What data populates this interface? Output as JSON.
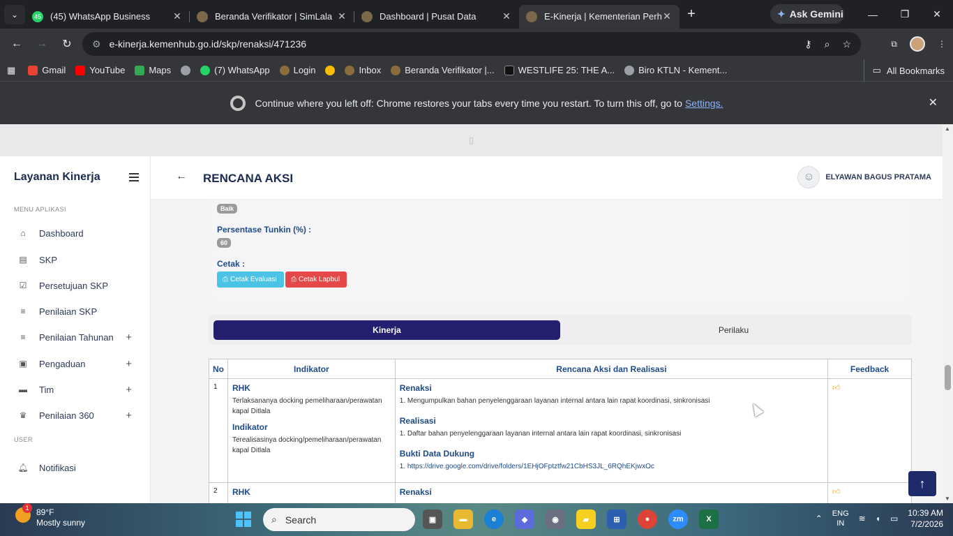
{
  "browser": {
    "tabs": [
      {
        "title": "(45) WhatsApp Business",
        "badge": "45",
        "color": "#25d366"
      },
      {
        "title": "Beranda Verifikator | SimLala",
        "badge": "",
        "color": "#8a8a8a"
      },
      {
        "title": "Dashboard | Pusat Data",
        "badge": "",
        "color": "#8a8a8a"
      },
      {
        "title": "E-Kinerja | Kementerian Perhub",
        "badge": "",
        "color": "#8a8a8a"
      }
    ],
    "gemini_label": "Ask Gemini",
    "url": "e-kinerja.kemenhub.go.id/skp/renaksi/471236",
    "bookmarks": [
      {
        "label": "Gmail",
        "color": "#ea4335"
      },
      {
        "label": "YouTube",
        "color": "#ff0000"
      },
      {
        "label": "Maps",
        "color": "#34a853"
      },
      {
        "label": "",
        "color": "#9aa0a6"
      },
      {
        "label": "(7) WhatsApp",
        "color": "#25d366"
      },
      {
        "label": "Login",
        "color": "#8a6d3b"
      },
      {
        "label": "",
        "color": "#fbbc04"
      },
      {
        "label": "Inbox",
        "color": "#8a6d3b"
      },
      {
        "label": "Beranda Verifikator |...",
        "color": "#8a6d3b"
      },
      {
        "label": "WESTLIFE 25: THE A...",
        "color": "#111111"
      },
      {
        "label": "Biro KTLN - Kement...",
        "color": "#9aa0a6"
      }
    ],
    "all_bookmarks": "All Bookmarks",
    "banner_text": "Continue where you left off: Chrome restores your tabs every time you restart. To turn this off, go to",
    "banner_link": "Settings."
  },
  "app": {
    "brand": "Layanan Kinerja",
    "menu_section": "MENU APLIKASI",
    "menu": [
      {
        "label": "Dashboard",
        "icon": "home-icon",
        "plus": false
      },
      {
        "label": "SKP",
        "icon": "document-icon",
        "plus": false
      },
      {
        "label": "Persetujuan SKP",
        "icon": "check-square-icon",
        "plus": false
      },
      {
        "label": "Penilaian SKP",
        "icon": "list-icon",
        "plus": false
      },
      {
        "label": "Penilaian Tahunan",
        "icon": "list-icon",
        "plus": true
      },
      {
        "label": "Pengaduan",
        "icon": "message-icon",
        "plus": true
      },
      {
        "label": "Tim",
        "icon": "tag-icon",
        "plus": true
      },
      {
        "label": "Penilaian 360",
        "icon": "crown-icon",
        "plus": true
      }
    ],
    "user_section": "USER",
    "user_menu": [
      {
        "label": "Notifikasi",
        "icon": "bell-icon"
      }
    ],
    "page_title": "RENCANA AKSI",
    "user_name": "ELYAWAN BAGUS PRATAMA"
  },
  "summary": {
    "rating_badge": "Baik",
    "tunkin_label": "Persentase Tunkin (%) :",
    "tunkin_value": "60",
    "cetak_label": "Cetak :",
    "btn_evaluasi": "Cetak Evaluasi",
    "btn_lapbul": "Cetak Lapbul"
  },
  "tabs": {
    "kinerja": "Kinerja",
    "perilaku": "Perilaku"
  },
  "table": {
    "headers": [
      "No",
      "Indikator",
      "Rencana Aksi dan Realisasi",
      "Feedback"
    ],
    "rows": [
      {
        "no": "1",
        "rhk_label": "RHK",
        "rhk_text": "Terlaksananya docking pemeliharaan/perawatan kapal Ditlala",
        "ind_label": "Indikator",
        "ind_text": "Terealisasinya docking/pemeliharaan/perawatan kapal Ditlala",
        "renaksi_label": "Renaksi",
        "renaksi_text": "1. Mengumpulkan bahan penyelenggaraan layanan internal antara lain rapat koordinasi, sinkronisasi",
        "realisasi_label": "Realisasi",
        "realisasi_text": "1. Daftar bahan penyelenggaraan layanan internal antara lain rapat koordinasi, sinkronisasi",
        "bukti_label": "Bukti Data Dukung",
        "bukti_num": "1.",
        "bukti_link": "https://drive.google.com/drive/folders/1EHjOFptztfw21CbHS3JL_6RQhEKjwxOc"
      },
      {
        "no": "2",
        "rhk_label": "RHK",
        "renaksi_label": "Renaksi"
      }
    ]
  },
  "taskbar": {
    "temp": "89°F",
    "weather": "Mostly sunny",
    "notif": "1",
    "search": "Search",
    "lang1": "ENG",
    "lang2": "IN",
    "time": "10:39 AM",
    "date": "7/2/2026"
  }
}
